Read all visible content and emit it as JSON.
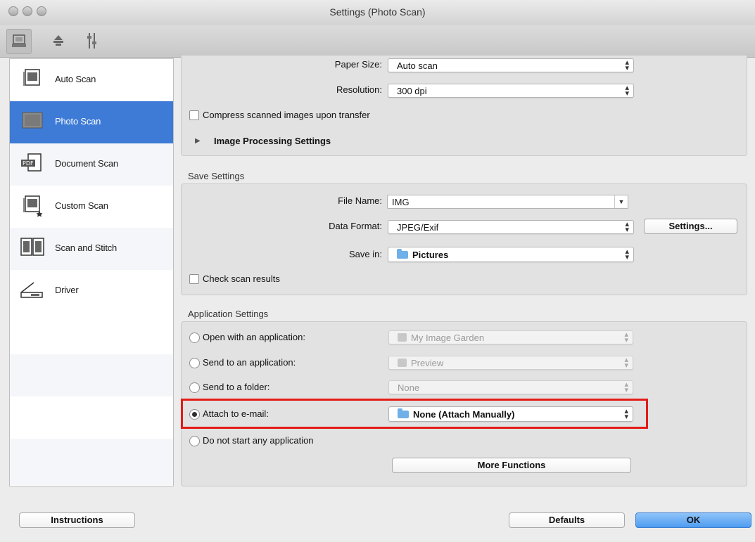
{
  "window": {
    "title": "Settings (Photo Scan)"
  },
  "toolbar": {
    "tools": [
      "scan-tab-icon",
      "network-tab-icon",
      "general-settings-tab-icon"
    ]
  },
  "sidebar": {
    "items": [
      {
        "label": "Auto Scan",
        "icon": "auto-scan-icon"
      },
      {
        "label": "Photo Scan",
        "icon": "photo-scan-icon",
        "selected": true
      },
      {
        "label": "Document Scan",
        "icon": "document-scan-icon"
      },
      {
        "label": "Custom Scan",
        "icon": "custom-scan-icon"
      },
      {
        "label": "Scan and Stitch",
        "icon": "scan-and-stitch-icon"
      },
      {
        "label": "Driver",
        "icon": "driver-icon"
      }
    ]
  },
  "scan_options": {
    "paper_size_label": "Paper Size:",
    "paper_size_value": "Auto scan",
    "resolution_label": "Resolution:",
    "resolution_value": "300 dpi",
    "compress_label": "Compress scanned images upon transfer",
    "image_processing_label": "Image Processing Settings"
  },
  "save_settings": {
    "heading": "Save Settings",
    "file_name_label": "File Name:",
    "file_name_value": "IMG",
    "data_format_label": "Data Format:",
    "data_format_value": "JPEG/Exif",
    "settings_button": "Settings...",
    "save_in_label": "Save in:",
    "save_in_value": "Pictures",
    "check_results_label": "Check scan results"
  },
  "app_settings": {
    "heading": "Application Settings",
    "open_with_label": "Open with an application:",
    "open_with_value": "My Image Garden",
    "send_to_app_label": "Send to an application:",
    "send_to_app_value": "Preview",
    "send_to_folder_label": "Send to a folder:",
    "send_to_folder_value": "None",
    "attach_label": "Attach to e-mail:",
    "attach_value": "None (Attach Manually)",
    "no_app_label": "Do not start any application",
    "more_functions": "More Functions"
  },
  "footer": {
    "instructions": "Instructions",
    "defaults": "Defaults",
    "ok": "OK"
  },
  "colors": {
    "accent": "#3d7bd6",
    "highlight": "#e41b17",
    "default_button": "#4e9cf0"
  }
}
